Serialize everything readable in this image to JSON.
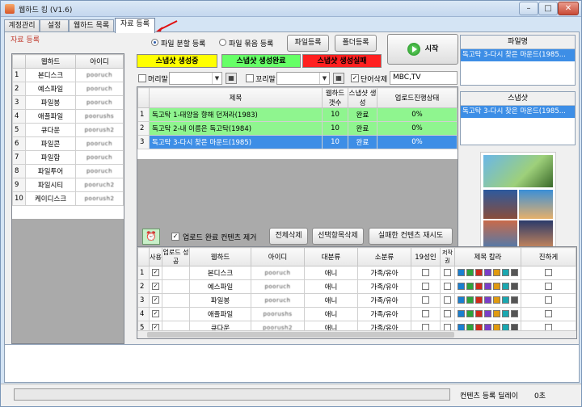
{
  "window": {
    "title": "웹하드 킹 (V1.6)",
    "controls": [
      "minimize-icon",
      "maximize-icon",
      "close-icon"
    ]
  },
  "tabs": [
    {
      "label": "계정관리"
    },
    {
      "label": "설정"
    },
    {
      "label": "웹하드 목록"
    },
    {
      "label": "자료 등록",
      "active": true
    }
  ],
  "section_label": "자료 등록",
  "webhard_table": {
    "headers": [
      "웹하드",
      "아이디"
    ],
    "rows": [
      {
        "num": "1",
        "name": "본디스크",
        "id": "pooruch"
      },
      {
        "num": "2",
        "name": "예스파일",
        "id": "pooruch"
      },
      {
        "num": "3",
        "name": "파일봉",
        "id": "pooruch"
      },
      {
        "num": "4",
        "name": "애플파일",
        "id": "poorushs"
      },
      {
        "num": "5",
        "name": "큐다운",
        "id": "poorush2"
      },
      {
        "num": "6",
        "name": "파일콘",
        "id": "pooruch"
      },
      {
        "num": "7",
        "name": "파일함",
        "id": "pooruch"
      },
      {
        "num": "8",
        "name": "파일투어",
        "id": "pooruch"
      },
      {
        "num": "9",
        "name": "파일시티",
        "id": "pooruch2"
      },
      {
        "num": "10",
        "name": "케이디스크",
        "id": "poorush2"
      }
    ]
  },
  "register_mode": {
    "option1": "파일 분할 등록",
    "option2": "파일 묶음 등록",
    "selected": "option1"
  },
  "buttons": {
    "file_register": "파일등록",
    "folder_register": "폴더등록",
    "start": "시작",
    "delete_all": "전체삭제",
    "delete_selected": "선택항목삭제",
    "retry_failed": "실패한 컨텐츠 재시도"
  },
  "legend": {
    "generating": "스냅샷 생성중",
    "done": "스냅샷 생성완료",
    "failed": "스냅샷 생성실패",
    "colors": {
      "generating": "#ffff00",
      "done": "#66ff66",
      "failed": "#ff2020"
    }
  },
  "options": {
    "header_label": "머리말",
    "tail_label": "꼬리말",
    "word_delete_label": "단어삭제",
    "word_delete_value": "MBC,TV",
    "remove_done_label": "업로드 완료 컨텐츠 제거"
  },
  "content_table": {
    "headers": [
      "제목",
      "웹하드 갯수",
      "스냅샷 생성",
      "업로드진행상태"
    ],
    "rows": [
      {
        "num": "1",
        "title": "독고탁 1-태양을 향해 던져라(1983)",
        "count": "10",
        "snapshot": "완료",
        "progress": "0%",
        "state": "green"
      },
      {
        "num": "2",
        "title": "독고탁 2-내 이름은 독고탁(1984)",
        "count": "10",
        "snapshot": "완료",
        "progress": "0%",
        "state": "green"
      },
      {
        "num": "3",
        "title": "독고탁 3-다시 찾은 마운드(1985)",
        "count": "10",
        "snapshot": "완료",
        "progress": "0%",
        "state": "selected"
      }
    ]
  },
  "right_panel": {
    "filename_header": "파일명",
    "filename_value": "독고탁 3-다시 찾은 마운드(1985...",
    "snapshot_header": "스냅샷",
    "snapshot_value": "독고탁 3-다시 찾은 마운드(1985..."
  },
  "upload_table": {
    "headers": [
      "사용",
      "업로드 성공",
      "웹하드",
      "아이디",
      "대분류",
      "소분류",
      "19성인",
      "저작권",
      "제목 칼라",
      "진하게"
    ],
    "rows": [
      {
        "num": "1",
        "name": "본디스크",
        "id": "pooruch",
        "major": "애니",
        "minor": "가족/유아"
      },
      {
        "num": "2",
        "name": "예스파일",
        "id": "pooruch",
        "major": "애니",
        "minor": "가족/유아"
      },
      {
        "num": "3",
        "name": "파일봉",
        "id": "pooruch",
        "major": "애니",
        "minor": "가족/유아"
      },
      {
        "num": "4",
        "name": "애플파일",
        "id": "poorushs",
        "major": "애니",
        "minor": "가족/유아"
      },
      {
        "num": "5",
        "name": "큐다운",
        "id": "poorush2",
        "major": "애니",
        "minor": "가족/유아"
      }
    ],
    "color_swatches": [
      "#1a7fd0",
      "#2da33a",
      "#d02a1a",
      "#7a3ec8",
      "#e09a10",
      "#1aa7b0",
      "#555555"
    ]
  },
  "status": {
    "delay_label": "컨텐츠 등록 딜레이",
    "delay_value": "0초"
  }
}
